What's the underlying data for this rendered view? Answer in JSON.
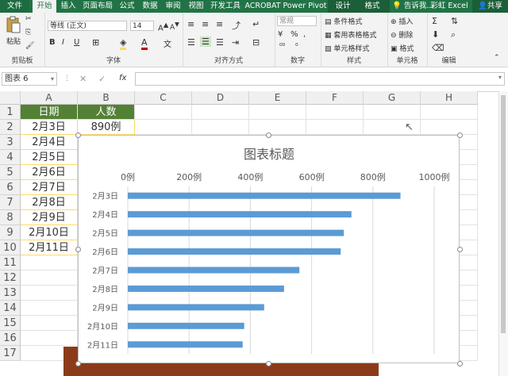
{
  "tabs": [
    "文件",
    "开始",
    "插入",
    "页面布局",
    "公式",
    "数据",
    "审阅",
    "视图",
    "开发工具",
    "ACROBAT",
    "Power Pivot",
    "设计",
    "格式"
  ],
  "tellme": "告诉我...",
  "app_title": "彩虹 Excel",
  "share_label": "共享",
  "ribbon": {
    "clipboard": {
      "label": "剪贴板",
      "paste": "粘贴"
    },
    "font": {
      "label": "字体",
      "font_name": "等线 (正文)",
      "font_size": "14",
      "bold": "B",
      "italic": "I",
      "underline": "U"
    },
    "alignment": {
      "label": "对齐方式"
    },
    "number": {
      "label": "数字",
      "format": "常规",
      "percent": "%",
      "comma": ","
    },
    "styles": {
      "label": "样式",
      "conditional": "条件格式",
      "table": "套用表格格式",
      "cell": "单元格样式"
    },
    "cells": {
      "label": "单元格",
      "insert": "插入",
      "delete": "删除",
      "format": "格式"
    },
    "editing": {
      "label": "编辑"
    }
  },
  "name_box": "图表 6",
  "fx_label": "fx",
  "columns": [
    "A",
    "B",
    "C",
    "D",
    "E",
    "F",
    "G",
    "H"
  ],
  "rows": [
    "1",
    "2",
    "3",
    "4",
    "5",
    "6",
    "7",
    "8",
    "9",
    "10",
    "11",
    "12",
    "13",
    "14",
    "15",
    "16",
    "17"
  ],
  "table": {
    "headers": [
      "日期",
      "人数"
    ],
    "dates": [
      "2月3日",
      "2月4日",
      "2月5日",
      "2月6日",
      "2月7日",
      "2月8日",
      "2月9日",
      "2月10日",
      "2月11日"
    ],
    "b2": "890例"
  },
  "chart_data": {
    "type": "bar",
    "title": "图表标题",
    "categories": [
      "2月3日",
      "2月4日",
      "2月5日",
      "2月6日",
      "2月7日",
      "2月8日",
      "2月9日",
      "2月10日",
      "2月11日"
    ],
    "values": [
      890,
      730,
      705,
      695,
      560,
      510,
      445,
      380,
      375
    ],
    "xlim": [
      0,
      1000
    ],
    "ticks": [
      "0例",
      "200例",
      "400例",
      "600例",
      "800例",
      "1000例"
    ],
    "axis_position": "top",
    "grid": true,
    "bar_color": "#5b9bd5"
  },
  "colors": {
    "ribbon_green": "#217346",
    "header_green": "#538135"
  }
}
